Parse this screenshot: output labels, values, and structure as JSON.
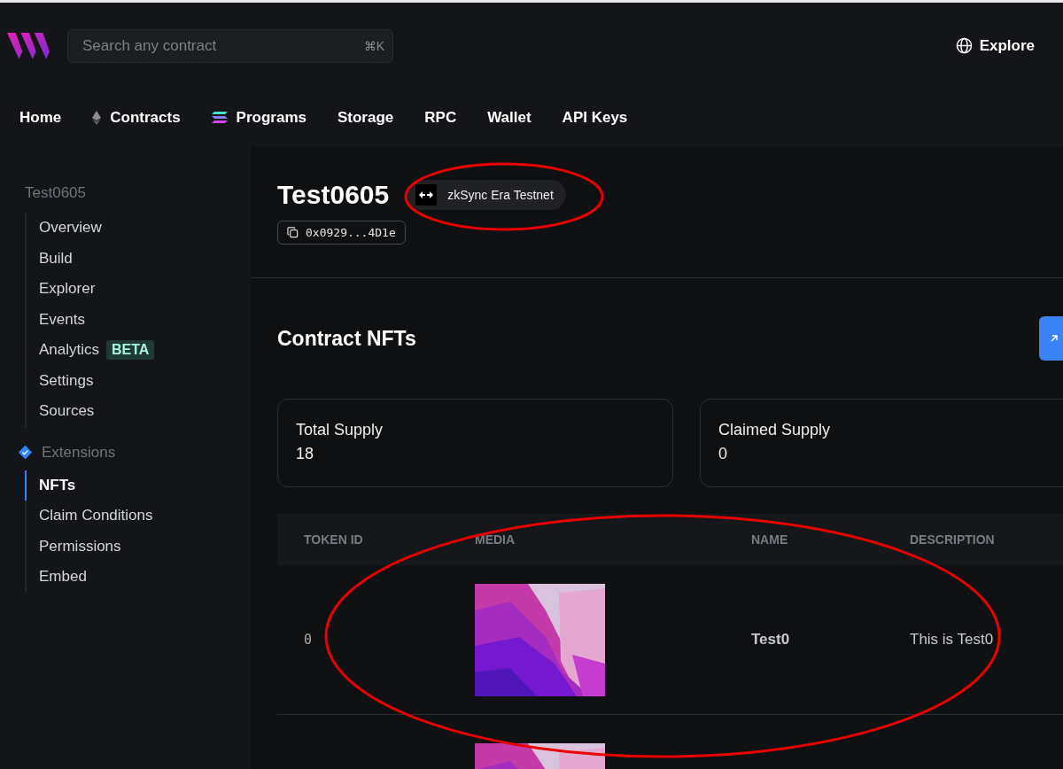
{
  "header": {
    "search": {
      "placeholder": "Search any contract",
      "shortcut": "⌘K"
    },
    "explore": "Explore"
  },
  "nav": [
    {
      "label": "Home"
    },
    {
      "label": "Contracts"
    },
    {
      "label": "Programs"
    },
    {
      "label": "Storage"
    },
    {
      "label": "RPC"
    },
    {
      "label": "Wallet"
    },
    {
      "label": "API Keys"
    }
  ],
  "sidebar": {
    "title": "Test0605",
    "items": [
      {
        "label": "Overview",
        "selected": false
      },
      {
        "label": "Build",
        "selected": false
      },
      {
        "label": "Explorer",
        "selected": false
      },
      {
        "label": "Events",
        "selected": false
      },
      {
        "label": "Analytics",
        "badge": "BETA",
        "selected": false
      },
      {
        "label": "Settings",
        "selected": false
      },
      {
        "label": "Sources",
        "selected": false
      }
    ],
    "section": {
      "title": "Extensions",
      "items": [
        {
          "label": "NFTs",
          "selected": true
        },
        {
          "label": "Claim Conditions",
          "selected": false
        },
        {
          "label": "Permissions",
          "selected": false
        },
        {
          "label": "Embed",
          "selected": false
        }
      ]
    }
  },
  "contract": {
    "name": "Test0605",
    "chain": "zkSync Era Testnet",
    "address": "0x0929...4D1e"
  },
  "section_title": "Contract NFTs",
  "stats": [
    {
      "label": "Total Supply",
      "value": "18"
    },
    {
      "label": "Claimed Supply",
      "value": "0"
    }
  ],
  "table": {
    "columns": [
      "TOKEN ID",
      "MEDIA",
      "NAME",
      "DESCRIPTION"
    ],
    "rows": [
      {
        "token_id": "0",
        "media": {
          "kind": "picture"
        },
        "name": "Test0",
        "description": "This is Test0"
      },
      {
        "media": {
          "kind": "picture"
        }
      }
    ]
  },
  "annotations": [
    {
      "kind": "ellipse"
    },
    {
      "kind": "ellipse"
    }
  ]
}
